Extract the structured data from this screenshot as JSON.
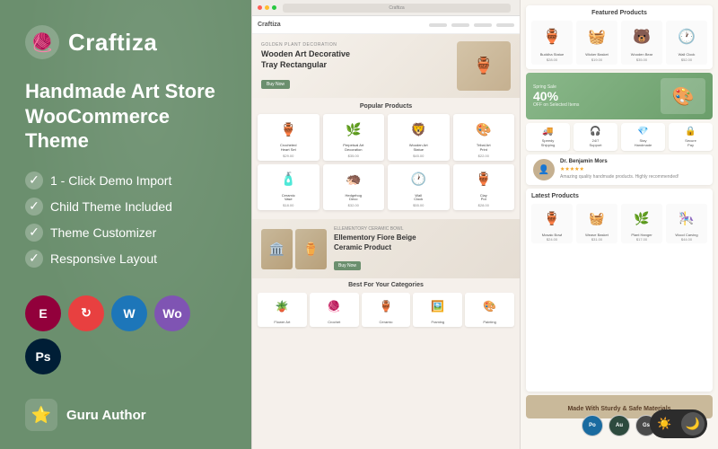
{
  "brand": {
    "name": "Craftiza",
    "logo_emoji": "🧶",
    "tagline_line1": "Handmade Art Store",
    "tagline_line2": "WooCommerce Theme"
  },
  "features": [
    {
      "id": "click-demo",
      "label": "1 - Click Demo Import"
    },
    {
      "id": "child-theme",
      "label": "Child Theme Included"
    },
    {
      "id": "customizer",
      "label": "Theme Customizer"
    },
    {
      "id": "responsive",
      "label": "Responsive Layout"
    }
  ],
  "badges": [
    {
      "id": "elementor",
      "label": "E",
      "class": "badge-elementor"
    },
    {
      "id": "update",
      "label": "↻",
      "class": "badge-update"
    },
    {
      "id": "wordpress",
      "label": "W",
      "class": "badge-wp"
    },
    {
      "id": "woocommerce",
      "label": "Wo",
      "class": "badge-woo"
    },
    {
      "id": "photoshop",
      "label": "Ps",
      "class": "badge-ps"
    }
  ],
  "author": {
    "icon": "⭐",
    "label": "Guru Author"
  },
  "center_preview": {
    "url": "Craftiza",
    "hero": {
      "subtitle": "GOLDEN PLANT DECORATION",
      "title": "Wooden Art Decorative\nTray Rectangular",
      "button": "Buy Now",
      "emoji": "🏺"
    },
    "popular_section": "Popular Products",
    "popular_products": [
      {
        "emoji": "🏺",
        "name": "Crocheted Heart Shape Set",
        "price": "$29.00"
      },
      {
        "emoji": "🌿",
        "name": "Perpetual Art Decoration",
        "price": "$35.00"
      },
      {
        "emoji": "🦁",
        "name": "Wooden Art Statue",
        "price": "$45.00"
      },
      {
        "emoji": "🎨",
        "name": "Tribal Art Print",
        "price": "$22.00"
      },
      {
        "emoji": "🧴",
        "name": "Ceramic Vase",
        "price": "$18.00"
      },
      {
        "emoji": "🦔",
        "name": "Hedgehog Deco",
        "price": "$32.00"
      },
      {
        "emoji": "🕐",
        "name": "Wall Clock",
        "price": "$55.00"
      }
    ],
    "promo": {
      "subtitle": "ELLEMENTORY CERAMIC BOWL",
      "title": "Ellementory Fiore Beige\nCeramic Product",
      "button": "Buy Now",
      "emoji": "🏛️"
    },
    "categories_section": "Best For Your Categories",
    "categories": [
      {
        "emoji": "🪴",
        "name": "Flower Art"
      },
      {
        "emoji": "🧶",
        "name": "Crochet Art"
      },
      {
        "emoji": "🏺",
        "name": "Ceramic Art"
      },
      {
        "emoji": "🖼️",
        "name": "Framing Art"
      },
      {
        "emoji": "🎨",
        "name": "Painting"
      }
    ]
  },
  "right_preview": {
    "featured_section": "Featured Products",
    "featured_products": [
      {
        "emoji": "🏺",
        "name": "Buddha Statue",
        "price": "$28.00"
      },
      {
        "emoji": "🧺",
        "name": "Wicker Basket",
        "price": "$19.00"
      },
      {
        "emoji": "🐻",
        "name": "Wooden Bear",
        "price": "$35.00"
      },
      {
        "emoji": "🕐",
        "name": "Wall Clock",
        "price": "$52.00"
      }
    ],
    "sale": {
      "small": "Spring Sale",
      "big": "40%",
      "sub": "OFF on Selected Items",
      "emoji": "🎨"
    },
    "review": {
      "name": "Dr. Benjamin Mors",
      "stars": "★★★★★",
      "text": "Amazing quality handmade products. Highly recommended!"
    },
    "trust_items": [
      {
        "icon": "🚚",
        "text": "Speedy Shipping"
      },
      {
        "icon": "🎧",
        "text": "24/7 Support"
      },
      {
        "icon": "💎",
        "text": "Stay Handmade"
      },
      {
        "icon": "🔒",
        "text": "Secure Pay"
      }
    ],
    "latest_section": "Latest Products",
    "latest_products": [
      {
        "emoji": "🏺",
        "name": "Mosaic Bowl",
        "price": "$24.00"
      },
      {
        "emoji": "🧺",
        "name": "Weave Basket",
        "price": "$31.00"
      },
      {
        "emoji": "🌿",
        "name": "Plant Hanger",
        "price": "$17.00"
      },
      {
        "emoji": "🎠",
        "name": "Wood Carving",
        "price": "$44.00"
      }
    ],
    "made_with": "Made With Sturdy & Safe Materials",
    "footer_logos": [
      {
        "id": "portal",
        "label": "Po",
        "class": "fp"
      },
      {
        "id": "auburn",
        "label": "Au",
        "class": "au"
      },
      {
        "id": "greatspace",
        "label": "Gs",
        "class": "gt"
      }
    ]
  },
  "dark_toggle": {
    "sun": "☀️",
    "moon": "🌙"
  }
}
